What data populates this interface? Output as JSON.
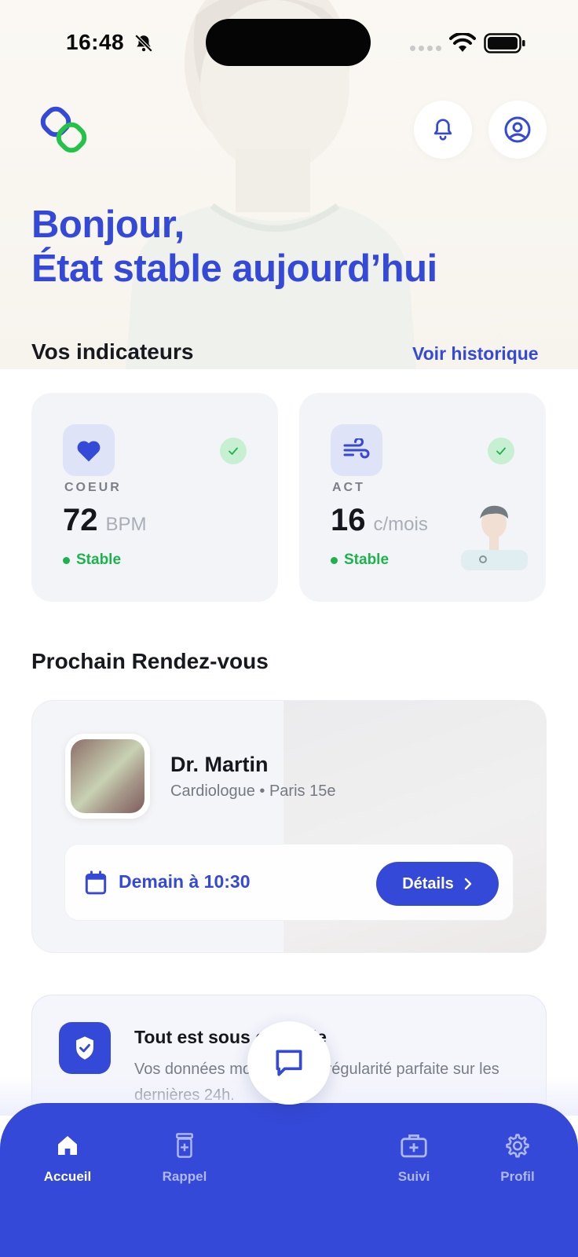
{
  "status_bar": {
    "time": "16:48"
  },
  "header": {
    "greeting_line1": "Bonjour,",
    "greeting_line2": "État stable aujourd’hui"
  },
  "indicators": {
    "title": "Vos indicateurs",
    "history_link": "Voir historique",
    "cards": [
      {
        "label": "COEUR",
        "value": "72",
        "unit": "BPM",
        "status": "Stable",
        "icon": "heart-icon"
      },
      {
        "label": "ACT",
        "value": "16",
        "unit": "c/mois",
        "status": "Stable",
        "icon": "wind-icon"
      }
    ]
  },
  "appointment": {
    "title": "Prochain Rendez-vous",
    "doctor": "Dr. Martin",
    "specialty": "Cardiologue • Paris 15e",
    "time": "Demain à 10:30",
    "details_label": "Détails"
  },
  "status_card": {
    "title": "Tout est sous contrôle",
    "text": "Vos données montrent une régularité parfaite sur les dernières 24h."
  },
  "nav": {
    "items": [
      {
        "label": "Accueil",
        "icon": "home-icon",
        "active": true
      },
      {
        "label": "Rappel",
        "icon": "pill-box-icon",
        "active": false
      },
      {
        "label": "Suivi",
        "icon": "medical-kit-icon",
        "active": false
      },
      {
        "label": "Profil",
        "icon": "gear-icon",
        "active": false
      }
    ]
  },
  "colors": {
    "primary": "#3549d8",
    "success": "#1db34c",
    "logo_blue": "#3549d8",
    "logo_green": "#23c248"
  }
}
